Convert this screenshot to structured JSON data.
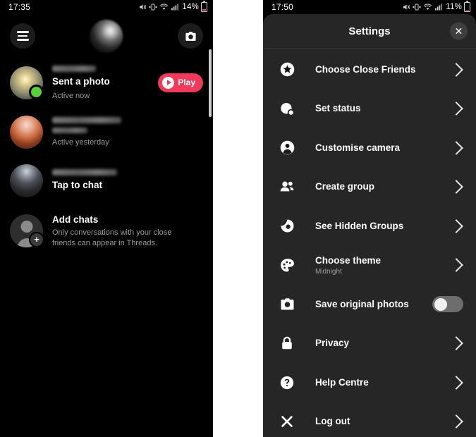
{
  "left_phone": {
    "statusbar": {
      "time": "17:35",
      "battery_pct": "14%",
      "icons": [
        "mute-icon",
        "vibrate-icon",
        "wifi-icon",
        "signal-icon",
        "battery-icon"
      ]
    },
    "header": {
      "menu_icon": "hamburger-menu-icon",
      "avatar": "profile-orb-avatar",
      "camera_icon": "camera-icon"
    },
    "chats": [
      {
        "name_redacted": true,
        "title": "Sent a photo",
        "subtitle": "Active now",
        "online": true,
        "action_label": "Play"
      },
      {
        "name_redacted": true,
        "title": "",
        "title_redacted": true,
        "subtitle": "Active yesterday",
        "online": false,
        "action_label": ""
      },
      {
        "name_redacted": true,
        "title": "Tap to chat",
        "subtitle": "",
        "online": false,
        "action_label": ""
      }
    ],
    "add_chats": {
      "title": "Add chats",
      "subtitle": "Only conversations with your close friends can appear in Threads."
    }
  },
  "right_phone": {
    "statusbar": {
      "time": "17:50",
      "battery_pct": "11%",
      "icons": [
        "mute-icon",
        "vibrate-icon",
        "wifi-icon",
        "signal-icon",
        "battery-icon"
      ]
    },
    "sheet": {
      "title": "Settings",
      "close_label": "×"
    },
    "items": [
      {
        "label": "Choose Close Friends",
        "sub": "",
        "icon": "star-icon",
        "control": "chevron"
      },
      {
        "label": "Set status",
        "sub": "",
        "icon": "status-circle-icon",
        "control": "chevron"
      },
      {
        "label": "Customise camera",
        "sub": "",
        "icon": "person-icon",
        "control": "chevron"
      },
      {
        "label": "Create group",
        "sub": "",
        "icon": "people-icon",
        "control": "chevron"
      },
      {
        "label": "See Hidden Groups",
        "sub": "",
        "icon": "eye-icon",
        "control": "chevron"
      },
      {
        "label": "Choose theme",
        "sub": "Midnight",
        "icon": "palette-icon",
        "control": "chevron"
      },
      {
        "label": "Save original photos",
        "sub": "",
        "icon": "camera-icon",
        "control": "toggle",
        "toggle_on": false
      },
      {
        "label": "Privacy",
        "sub": "",
        "icon": "lock-icon",
        "control": "chevron"
      },
      {
        "label": "Help Centre",
        "sub": "",
        "icon": "question-icon",
        "control": "chevron"
      },
      {
        "label": "Log out",
        "sub": "",
        "icon": "close-x-icon",
        "control": "chevron"
      }
    ]
  },
  "colors": {
    "accent_play": "#f1395c",
    "online_dot": "#58d03a",
    "sheet_bg": "#262626",
    "screen_bg": "#000000"
  }
}
